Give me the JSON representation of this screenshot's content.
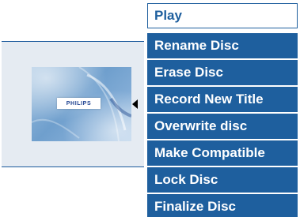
{
  "disc_preview": {
    "brand_label": "PHILIPS"
  },
  "menu": {
    "selected_index": 0,
    "items": [
      {
        "label": "Play"
      },
      {
        "label": "Rename Disc"
      },
      {
        "label": "Erase Disc"
      },
      {
        "label": "Record New Title"
      },
      {
        "label": "Overwrite disc"
      },
      {
        "label": "Make Compatible"
      },
      {
        "label": "Lock Disc"
      },
      {
        "label": "Finalize Disc"
      }
    ]
  },
  "colors": {
    "menu_background": "#1e5f9e",
    "menu_text": "#ffffff",
    "selected_background": "#ffffff",
    "selected_text": "#1e5f9e",
    "preview_background": "#e5ebf2"
  }
}
